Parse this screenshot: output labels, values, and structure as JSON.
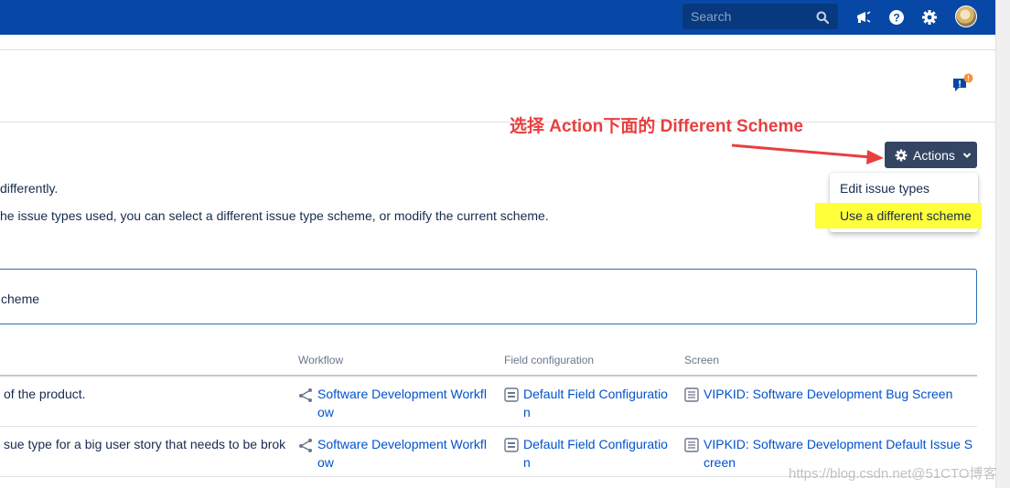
{
  "header": {
    "search_placeholder": "Search",
    "icons": [
      "announcement-icon",
      "help-icon",
      "settings-icon"
    ]
  },
  "annotation": {
    "text": "选择 Action下面的 Different Scheme",
    "color": "#e83f3f"
  },
  "actions": {
    "button_label": "Actions",
    "menu": [
      {
        "label": "Edit issue types",
        "highlighted": false
      },
      {
        "label": "Use a different scheme",
        "highlighted": true
      }
    ]
  },
  "description": {
    "line1": "differently.",
    "line2": "he issue types used, you can select a different issue type scheme, or modify the current scheme."
  },
  "panel": {
    "text": "cheme"
  },
  "table": {
    "headers": {
      "workflow": "Workflow",
      "field_configuration": "Field configuration",
      "screen": "Screen"
    },
    "rows": [
      {
        "description": "of the product.",
        "workflow": [
          "Software Development Workfl",
          "ow"
        ],
        "field_config": [
          "Default Field Configuratio",
          "n"
        ],
        "screen": [
          "VIPKID: Software Development Bug Screen"
        ]
      },
      {
        "description": "sue type for a big user story that needs to be brok",
        "workflow": [
          "Software Development Workfl",
          "ow"
        ],
        "field_config": [
          "Default Field Configuratio",
          "n"
        ],
        "screen": [
          "VIPKID: Software Development Default Issue S",
          "creen"
        ]
      }
    ]
  },
  "watermark": "https://blog.csdn.net@51CTO博客",
  "colors": {
    "topbar": "#0747a6",
    "link": "#0052cc",
    "actions_button": "#344563",
    "highlight": "#ffff3a"
  }
}
